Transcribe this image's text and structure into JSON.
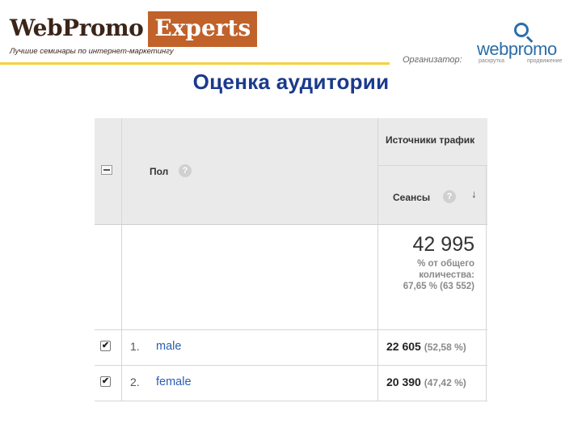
{
  "header": {
    "logo_part1": "WebPromo",
    "logo_part2": "Experts",
    "tagline": "Лучшие семинары по интернет-маркетингу",
    "organizer_label": "Организатор:",
    "organizer_logo": "webpromo",
    "organizer_sub1": "раскрутка",
    "organizer_sub2": "продвижение",
    "brand_color": "#c0622a",
    "accent_line_color": "#f4d23a"
  },
  "page_title": "Оценка аудитории",
  "table": {
    "group_header": "Источники трафик",
    "dimension_header": "Пол",
    "metric_header": "Сеансы",
    "help_icon": "question-icon",
    "sort_icon": "arrow-down-icon",
    "total_value": "42 995",
    "total_line1": "% от общего",
    "total_line2": "количества:",
    "total_line3": "67,65 % (63 552)",
    "rows": [
      {
        "num": "1.",
        "label": "male",
        "value": "22 605",
        "pct": "(52,58 %)",
        "checked": true
      },
      {
        "num": "2.",
        "label": "female",
        "value": "20 390",
        "pct": "(47,42 %)",
        "checked": true
      }
    ]
  }
}
